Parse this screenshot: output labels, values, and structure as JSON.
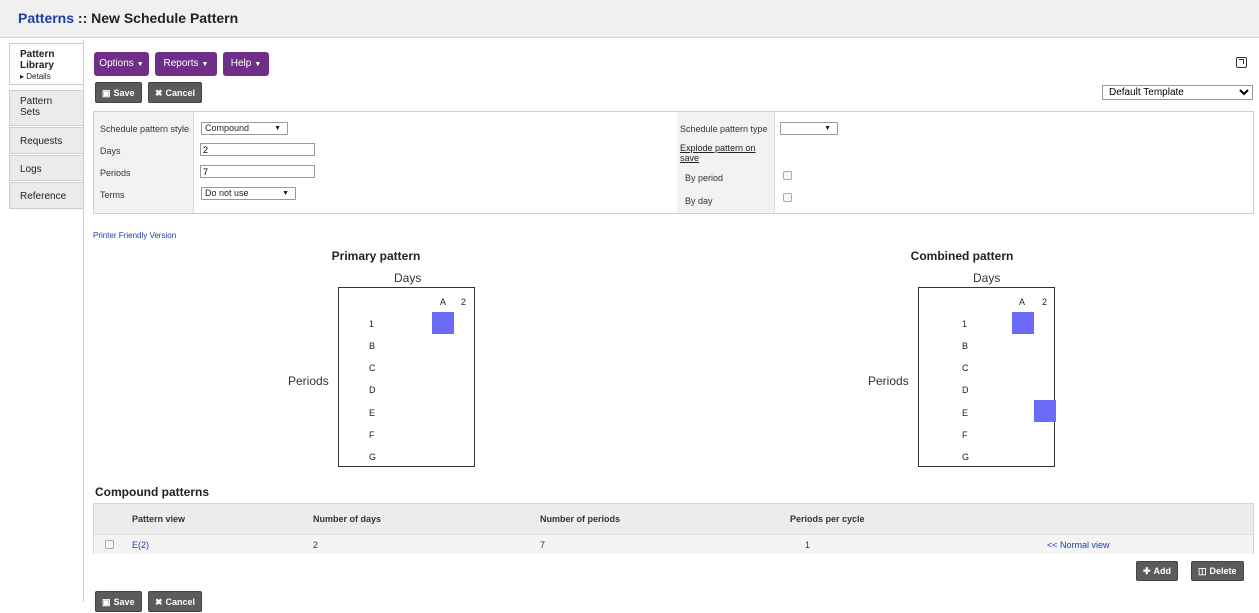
{
  "header": {
    "module": "Patterns",
    "separator": " :: ",
    "title": "New Schedule Pattern"
  },
  "sidebar": {
    "tabs": [
      {
        "label": "Pattern Library",
        "sub": "▸ Details"
      },
      {
        "label": "Pattern Sets"
      },
      {
        "label": "Requests"
      },
      {
        "label": "Logs"
      },
      {
        "label": "Reference"
      }
    ]
  },
  "menu": {
    "options": "Options",
    "reports": "Reports",
    "help": "Help"
  },
  "toolbar": {
    "save": "Save",
    "cancel": "Cancel",
    "template": "Default Template"
  },
  "form": {
    "style_label": "Schedule pattern style",
    "style_value": "Compound",
    "days_label": "Days",
    "days_value": "2",
    "periods_label": "Periods",
    "periods_value": "7",
    "terms_label": "Terms",
    "terms_value": "Do not use",
    "type_label": "Schedule pattern type",
    "type_value": "",
    "explode_label": "Explode pattern on save",
    "by_period_label": "By period",
    "by_day_label": "By day"
  },
  "printer_link": "Printer Friendly Version",
  "primary": {
    "title": "Primary pattern",
    "days_label": "Days",
    "periods_label": "Periods",
    "days": [
      "A",
      "2"
    ],
    "periods": [
      "1",
      "B",
      "C",
      "D",
      "E",
      "F",
      "G"
    ]
  },
  "combined": {
    "title": "Combined pattern",
    "days_label": "Days",
    "periods_label": "Periods",
    "days": [
      "A",
      "2"
    ],
    "periods": [
      "1",
      "B",
      "C",
      "D",
      "E",
      "F",
      "G"
    ]
  },
  "compound": {
    "title": "Compound patterns",
    "headers": [
      "Pattern view",
      "Number of days",
      "Number of periods",
      "Periods per cycle"
    ],
    "row": {
      "view": "E(2)",
      "days": "2",
      "periods": "7",
      "per_cycle": "1",
      "action": "<< Normal view"
    },
    "add": "Add",
    "delete": "Delete"
  },
  "colors": {
    "accent": "#6f2f88",
    "cell": "#6b6bf7",
    "link": "#1d3ea8"
  }
}
